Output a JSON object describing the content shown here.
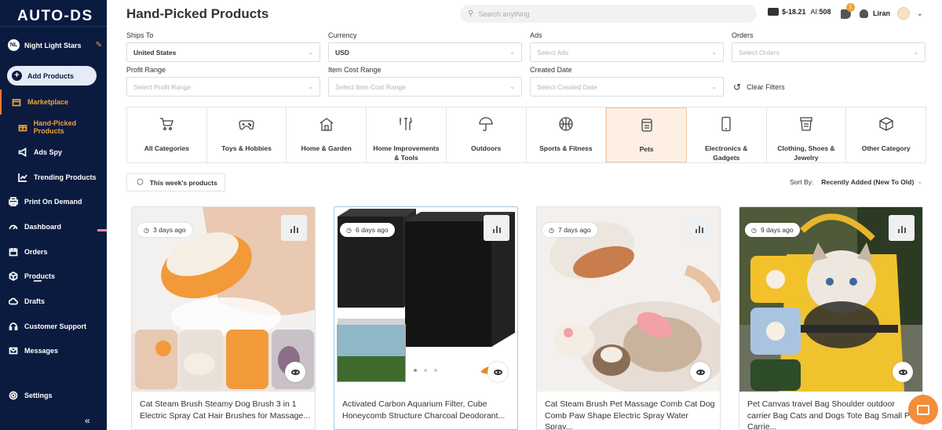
{
  "sidebar": {
    "logo": "AUTO-DS",
    "store_name": "Night Light Stars",
    "store_initials": "NL",
    "add_products": "Add Products",
    "items": [
      {
        "label": "Marketplace",
        "icon": "store-icon"
      },
      {
        "label": "Hand-Picked Products",
        "icon": "gift-icon"
      },
      {
        "label": "Ads Spy",
        "icon": "megaphone-icon"
      },
      {
        "label": "Trending Products",
        "icon": "trend-icon"
      },
      {
        "label": "Print On Demand",
        "icon": "printer-icon"
      },
      {
        "label": "Dashboard",
        "icon": "gauge-icon"
      },
      {
        "label": "Orders",
        "icon": "calendar-icon"
      },
      {
        "label": "Products",
        "icon": "box-icon"
      },
      {
        "label": "Drafts",
        "icon": "cloud-icon"
      },
      {
        "label": "Customer Support",
        "icon": "headset-icon"
      },
      {
        "label": "Messages",
        "icon": "mail-icon"
      },
      {
        "label": "Settings",
        "icon": "gear-icon"
      }
    ]
  },
  "header": {
    "title": "Hand-Picked Products",
    "search_placeholder": "Search anything",
    "balance": "$-18.21",
    "ai_label": "AI:",
    "ai_value": "508",
    "notifications": "1",
    "user": "Liran"
  },
  "filters": {
    "ships_to": {
      "label": "Ships To",
      "value": "United States"
    },
    "currency": {
      "label": "Currency",
      "value": "USD"
    },
    "ads": {
      "label": "Ads",
      "placeholder": "Select Ads"
    },
    "orders": {
      "label": "Orders",
      "placeholder": "Select Orders"
    },
    "profit": {
      "label": "Profit Range",
      "placeholder": "Select Profit Range"
    },
    "item_cost": {
      "label": "Item Cost Range",
      "placeholder": "Select Item Cost Range"
    },
    "created": {
      "label": "Created Date",
      "placeholder": "Select Created Date"
    },
    "clear": "Clear Filters"
  },
  "categories": [
    {
      "l1": "All Categories",
      "l2": "",
      "icon": "cart-icon"
    },
    {
      "l1": "Toys & Hobbies",
      "l2": "",
      "icon": "gamepad-icon"
    },
    {
      "l1": "Home & Garden",
      "l2": "",
      "icon": "house-icon"
    },
    {
      "l1": "Home Improvements",
      "l2": "& Tools",
      "icon": "tools-icon"
    },
    {
      "l1": "Outdoors",
      "l2": "",
      "icon": "umbrella-icon"
    },
    {
      "l1": "Sports & Fitness",
      "l2": "",
      "icon": "ball-icon"
    },
    {
      "l1": "Pets",
      "l2": "",
      "icon": "pet-food-icon"
    },
    {
      "l1": "Electronics &",
      "l2": "Gadgets",
      "icon": "phone-icon"
    },
    {
      "l1": "Clothing, Shoes &",
      "l2": "Jewelry",
      "icon": "clothes-icon"
    },
    {
      "l1": "Other Category",
      "l2": "",
      "icon": "cube-icon"
    }
  ],
  "active_category": "Pets",
  "week_label": "This week's products",
  "sort": {
    "label": "Sort By:",
    "value": "Recently Added (New To Old)"
  },
  "products": [
    {
      "age": "3 days ago",
      "title": "Cat Steam Brush Steamy Dog Brush 3 in 1 Electric Spray Cat Hair Brushes for Massage..."
    },
    {
      "age": "6 days ago",
      "title": "Activated Carbon Aquarium Filter, Cube Honeycomb Structure Charcoal Deodorant..."
    },
    {
      "age": "7 days ago",
      "title": "Cat Steam Brush Pet Massage Comb Cat Dog Comb Paw Shape Electric Spray Water Spray..."
    },
    {
      "age": "9 days ago",
      "title": "Pet Canvas travel Bag Shoulder outdoor carrier Bag Cats and Dogs Tote Bag Small Pet Carrie..."
    }
  ]
}
